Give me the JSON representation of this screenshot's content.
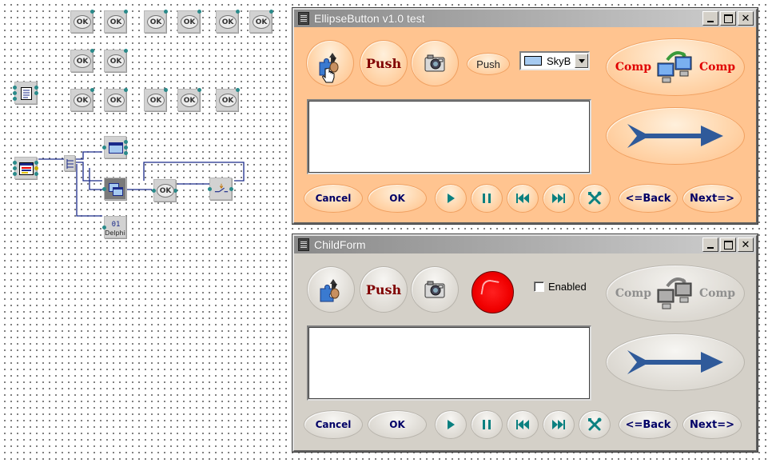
{
  "canvas": {
    "ok_label": "OK",
    "delphi_label": "Delphi",
    "counter_label": "01"
  },
  "window1": {
    "title": "EllipseButton v1.0 test",
    "push_label": "Push",
    "push_small_label": "Push",
    "combo_value": "SkyB",
    "comp_left": "Comp",
    "comp_right": "Comp",
    "cancel_label": "Cancel",
    "ok_label": "OK",
    "back_label": "<=Back",
    "next_label": "Next=>",
    "memo_text": ""
  },
  "window2": {
    "title": "ChildForm",
    "push_label": "Push",
    "enabled_label": "Enabled",
    "enabled_checked": false,
    "comp_left": "Comp",
    "comp_right": "Comp",
    "cancel_label": "Cancel",
    "ok_label": "OK",
    "back_label": "<=Back",
    "next_label": "Next=>",
    "memo_text": ""
  },
  "colors": {
    "window1_bg": "#ffc490",
    "window2_bg": "#d4d0c8",
    "accent_teal": "#0a8080",
    "arrow_blue": "#2f5a9a",
    "comp_red": "#e00000",
    "led_red": "#f00000"
  }
}
